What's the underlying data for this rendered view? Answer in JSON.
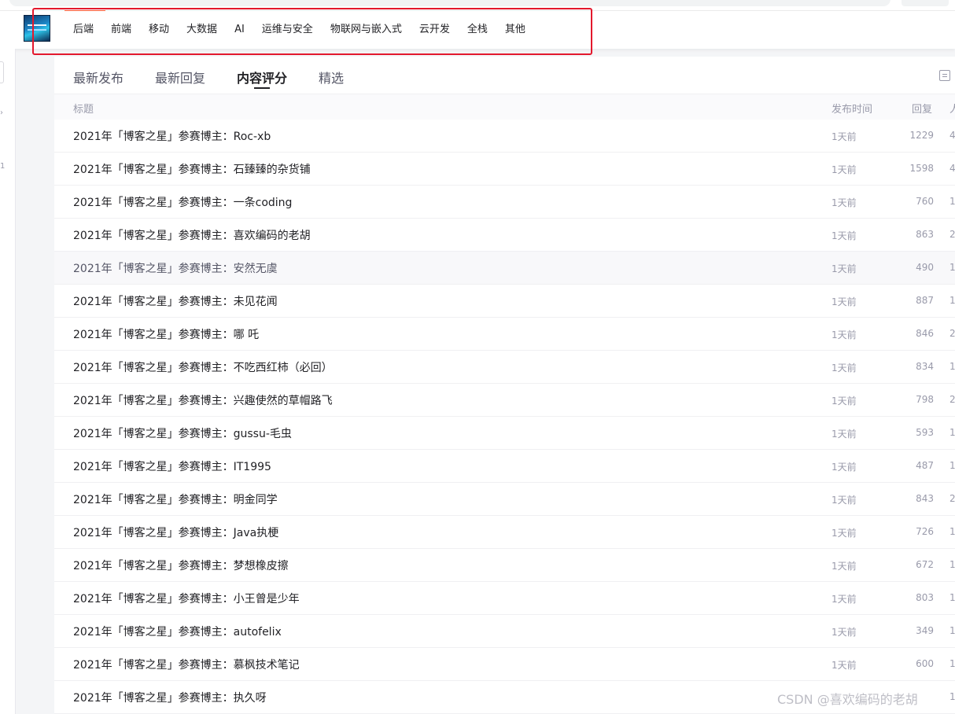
{
  "nav": {
    "items": [
      "后端",
      "前端",
      "移动",
      "大数据",
      "AI",
      "运维与安全",
      "物联网与嵌入式",
      "云开发",
      "全栈",
      "其他"
    ]
  },
  "tabs": [
    "最新发布",
    "最新回复",
    "内容评分",
    "精选"
  ],
  "active_tab": "内容评分",
  "table": {
    "headers": {
      "title": "标题",
      "time": "发布时间",
      "reply": "回复",
      "extra": "人"
    },
    "rows": [
      {
        "title": "2021年「博客之星」参赛博主：Roc-xb",
        "time": "1天前",
        "reply": "1229",
        "extra": "4"
      },
      {
        "title": "2021年「博客之星」参赛博主：石臻臻的杂货铺",
        "time": "1天前",
        "reply": "1598",
        "extra": "4"
      },
      {
        "title": "2021年「博客之星」参赛博主：一条coding",
        "time": "1天前",
        "reply": "760",
        "extra": "1"
      },
      {
        "title": "2021年「博客之星」参赛博主：喜欢编码的老胡",
        "time": "1天前",
        "reply": "863",
        "extra": "2"
      },
      {
        "title": "2021年「博客之星」参赛博主：安然无虞",
        "time": "1天前",
        "reply": "490",
        "extra": "1"
      },
      {
        "title": "2021年「博客之星」参赛博主：未见花闻",
        "time": "1天前",
        "reply": "887",
        "extra": "1"
      },
      {
        "title": "2021年「博客之星」参赛博主：哪 吒",
        "time": "1天前",
        "reply": "846",
        "extra": "2"
      },
      {
        "title": "2021年「博客之星」参赛博主：不吃西红柿（必回）",
        "time": "1天前",
        "reply": "834",
        "extra": "1"
      },
      {
        "title": "2021年「博客之星」参赛博主：兴趣使然的草帽路飞",
        "time": "1天前",
        "reply": "798",
        "extra": "2"
      },
      {
        "title": "2021年「博客之星」参赛博主：gussu-毛虫",
        "time": "1天前",
        "reply": "593",
        "extra": "1"
      },
      {
        "title": "2021年「博客之星」参赛博主：IT1995",
        "time": "1天前",
        "reply": "487",
        "extra": "1"
      },
      {
        "title": "2021年「博客之星」参赛博主：明金同学",
        "time": "1天前",
        "reply": "843",
        "extra": "2"
      },
      {
        "title": "2021年「博客之星」参赛博主：Java执梗",
        "time": "1天前",
        "reply": "726",
        "extra": "1"
      },
      {
        "title": "2021年「博客之星」参赛博主：梦想橡皮擦",
        "time": "1天前",
        "reply": "672",
        "extra": "1"
      },
      {
        "title": "2021年「博客之星」参赛博主：小王曾是少年",
        "time": "1天前",
        "reply": "803",
        "extra": "1"
      },
      {
        "title": "2021年「博客之星」参赛博主：autofelix",
        "time": "1天前",
        "reply": "349",
        "extra": "1"
      },
      {
        "title": "2021年「博客之星」参赛博主：慕枫技术笔记",
        "time": "1天前",
        "reply": "600",
        "extra": "1"
      },
      {
        "title": "2021年「博客之星」参赛博主：执久呀",
        "time": "",
        "reply": "",
        "extra": "1"
      }
    ]
  },
  "watermark": "CSDN @喜欢编码的老胡",
  "colors": {
    "accent": "#fc5531",
    "highlight_box": "#e3182d",
    "text_primary": "#222226",
    "text_secondary": "#999aaa"
  },
  "icons": {
    "logo": "site-logo",
    "tab_tool": "list-view-icon"
  }
}
